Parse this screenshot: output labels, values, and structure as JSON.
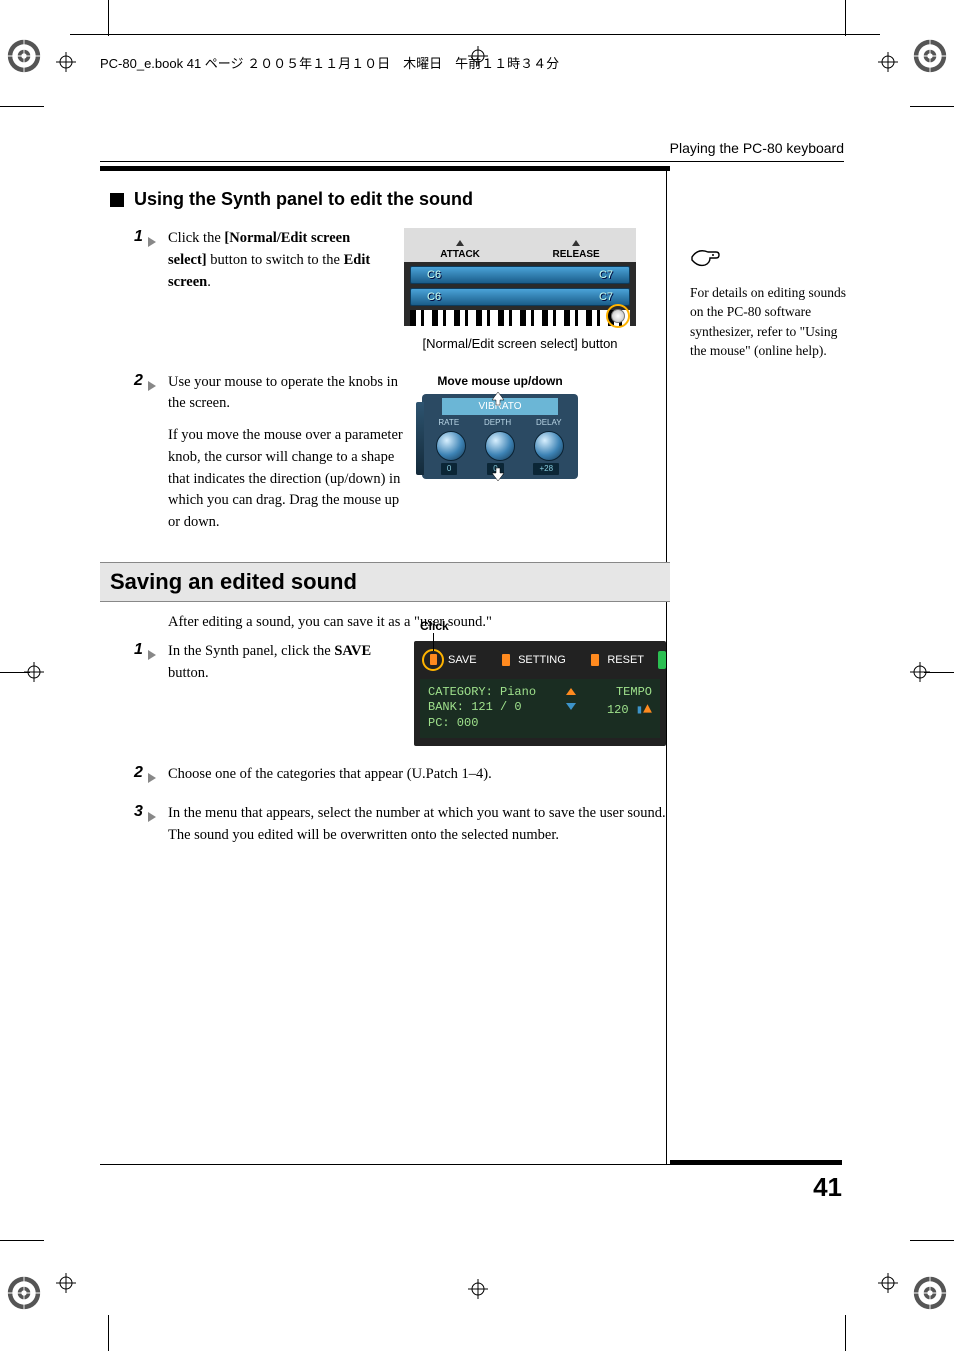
{
  "doc_header": "PC-80_e.book 41 ページ ２００５年１１月１０日　木曜日　午前１１時３４分",
  "running_head": "Playing the PC-80 keyboard",
  "page_number": "41",
  "section1": {
    "title": "Using the Synth panel to edit the sound",
    "step1": {
      "num": "1",
      "text_pre": "Click the ",
      "text_bold1": "[Normal/Edit screen select]",
      "text_mid": " button to switch to the ",
      "text_bold2": "Edit screen",
      "text_post": ".",
      "fig_caption": "[Normal/Edit screen select] button",
      "fig": {
        "attack": "ATTACK",
        "release": "RELEASE",
        "oct_a": "C6",
        "oct_b": "C7"
      }
    },
    "step2": {
      "num": "2",
      "para1": "Use your mouse to operate the knobs in the screen.",
      "para2": "If you move the mouse over a parameter knob, the cursor will change to a shape that indicates the direction (up/down) in which you can drag. Drag the mouse up or down.",
      "fig_caption_top": "Move mouse up/down",
      "fig": {
        "title": "VIBRATO",
        "labels": [
          "RATE",
          "DEPTH",
          "DELAY"
        ],
        "values": [
          "0",
          "0",
          "+28"
        ]
      }
    }
  },
  "section2": {
    "title": "Saving an edited sound",
    "intro": "After editing a sound, you can save it as a \"user sound.\"",
    "click_label": "Click",
    "step1": {
      "num": "1",
      "text_pre": "In the Synth panel, click the ",
      "text_bold": "SAVE",
      "text_post": " button.",
      "fig": {
        "save": "SAVE",
        "setting": "SETTING",
        "reset": "RESET",
        "lcd_left": "CATEGORY: Piano\nBANK: 121 / 0\nPC: 000",
        "lcd_right_label": "TEMPO",
        "lcd_right_val": "120"
      }
    },
    "step2": {
      "num": "2",
      "text": "Choose one of the categories that appear (U.Patch 1–4)."
    },
    "step3": {
      "num": "3",
      "text": "In the menu that appears, select the number at which you want to save the user sound. The sound you edited will be overwritten onto the selected number."
    }
  },
  "sidenote": {
    "text": "For details on editing sounds on the PC-80 software synthesizer, refer to \"Using the mouse\" (online help)."
  }
}
